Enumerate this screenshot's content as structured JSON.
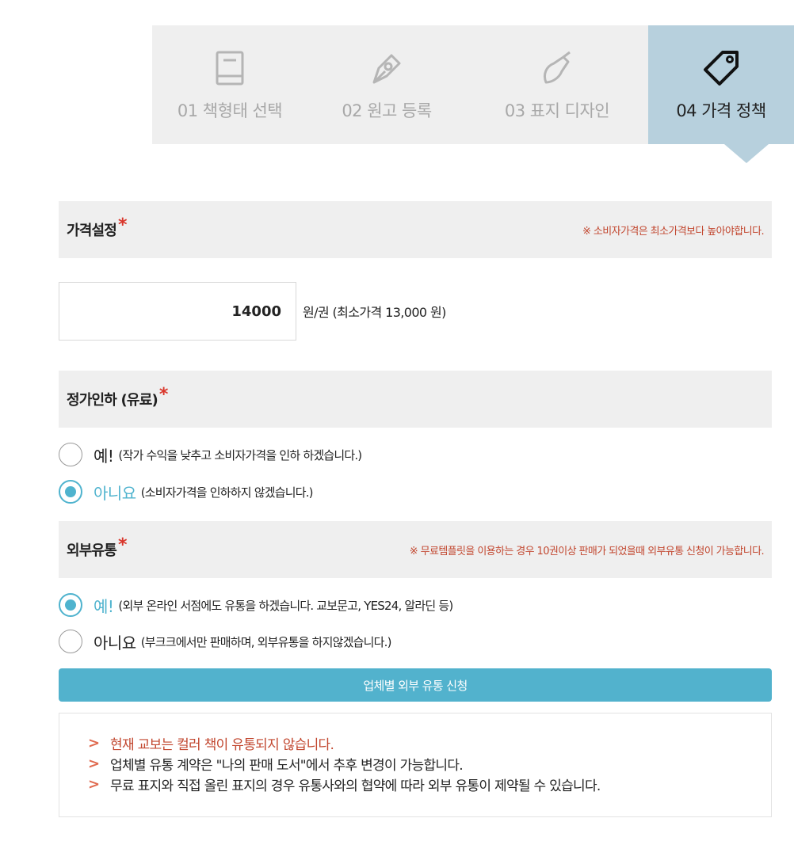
{
  "steps": [
    {
      "label": "01 책형태 선택",
      "icon": "book-icon"
    },
    {
      "label": "02 원고 등록",
      "icon": "pen-nib-icon"
    },
    {
      "label": "03 표지 디자인",
      "icon": "paint-brush-icon"
    },
    {
      "label": "04 가격 정책",
      "icon": "price-tag-icon"
    }
  ],
  "price_section": {
    "title": "가격설정",
    "star": "*",
    "note": "※ 소비자가격은 최소가격보다 높아야합니다.",
    "input_value": "14000",
    "unit_text": "원/권 (최소가격 13,000 원)"
  },
  "discount_section": {
    "title": "정가인하 (유료)",
    "star": "*",
    "options": [
      {
        "big": "예!",
        "small": "(작가 수익을 낮추고 소비자가격을 인하 하겠습니다.)",
        "selected": false
      },
      {
        "big": "아니요",
        "small": "(소비자가격을 인하하지 않겠습니다.)",
        "selected": true
      }
    ]
  },
  "distribution_section": {
    "title": "외부유통",
    "star": "*",
    "note": "※ 무료템플릿을 이용하는 경우 10권이상 판매가 되었을때 외부유통 신청이 가능합니다.",
    "options": [
      {
        "big": "예!",
        "small": "(외부 온라인 서점에도 유통을 하겠습니다. 교보문고, YES24, 알라딘 등)",
        "selected": true
      },
      {
        "big": "아니요",
        "small": "(부크크에서만 판매하며, 외부유통을 하지않겠습니다.)",
        "selected": false
      }
    ]
  },
  "apply_button": "업체별 외부 유통 신청",
  "info": [
    "현재 교보는 컬러 책이 유통되지 않습니다.",
    "업체별 유통 계약은 \"나의 판매 도서\"에서 추후 변경이 가능합니다.",
    "무료 표지와 직접 올린 표지의 경우 유통사와의 협약에 따라 외부 유통이 제약될 수 있습니다."
  ],
  "colors": {
    "accent": "#52b2cd",
    "warning": "#c2472f",
    "active_step": "#b7d0dd"
  }
}
